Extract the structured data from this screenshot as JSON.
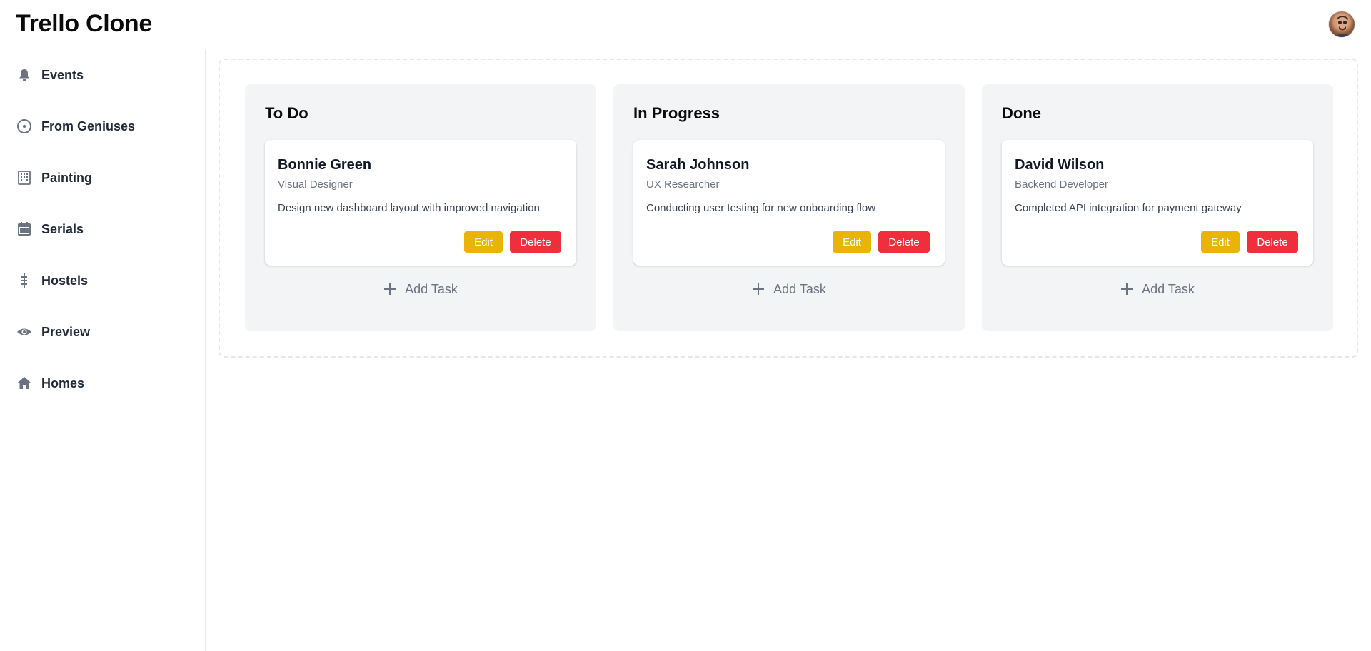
{
  "header": {
    "title": "Trello Clone",
    "avatar_icon": "user-avatar"
  },
  "sidebar": {
    "items": [
      {
        "label": "Events",
        "icon": "bell-icon"
      },
      {
        "label": "From Geniuses",
        "icon": "target-circle-icon"
      },
      {
        "label": "Painting",
        "icon": "building-icon"
      },
      {
        "label": "Serials",
        "icon": "calendar-icon"
      },
      {
        "label": "Hostels",
        "icon": "tower-icon"
      },
      {
        "label": "Preview",
        "icon": "eye-icon"
      },
      {
        "label": "Homes",
        "icon": "home-icon"
      }
    ]
  },
  "columns": [
    {
      "title": "To Do",
      "cards": [
        {
          "name": "Bonnie Green",
          "role": "Visual Designer",
          "description": "Design new dashboard layout with improved navigation",
          "edit_label": "Edit",
          "delete_label": "Delete"
        }
      ],
      "add_label": "Add Task"
    },
    {
      "title": "In Progress",
      "cards": [
        {
          "name": "Sarah Johnson",
          "role": "UX Researcher",
          "description": "Conducting user testing for new onboarding flow",
          "edit_label": "Edit",
          "delete_label": "Delete"
        }
      ],
      "add_label": "Add Task"
    },
    {
      "title": "Done",
      "cards": [
        {
          "name": "David Wilson",
          "role": "Backend Developer",
          "description": "Completed API integration for payment gateway",
          "edit_label": "Edit",
          "delete_label": "Delete"
        }
      ],
      "add_label": "Add Task"
    }
  ],
  "colors": {
    "edit": "#eab308",
    "delete": "#ef2f3c",
    "column_bg": "#f3f4f6"
  }
}
